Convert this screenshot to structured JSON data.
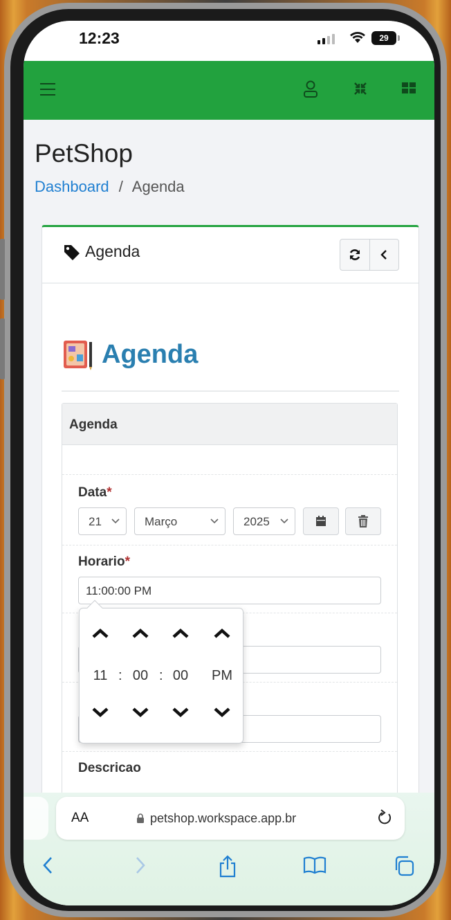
{
  "status": {
    "time": "12:23",
    "battery": "29"
  },
  "app": {
    "title": "PetShop",
    "breadcrumb": {
      "home": "Dashboard",
      "separator": "/",
      "current": "Agenda"
    }
  },
  "card": {
    "title": "Agenda",
    "heading": "Agenda",
    "panel_title": "Agenda"
  },
  "form": {
    "data_label": "Data",
    "day": "21",
    "month": "Março",
    "year": "2025",
    "horario_label": "Horario",
    "horario_value": "11:00:00 PM",
    "descricao_label": "Descricao",
    "required_mark": "*"
  },
  "time_picker": {
    "hour": "11",
    "minute": "00",
    "second": "00",
    "period": "PM",
    "separator": ":"
  },
  "browser": {
    "text_size_label": "AA",
    "url": "petshop.workspace.app.br"
  },
  "colors": {
    "brand_green": "#22a23e",
    "link_blue": "#1f7fd1",
    "heading_blue": "#2a7fb0",
    "required_red": "#b03030"
  },
  "icons": [
    "menu-icon",
    "user-icon",
    "compress-icon",
    "grid-icon",
    "tag-icon",
    "refresh-icon",
    "chevron-left-icon",
    "calendar-icon",
    "trash-icon",
    "chevron-up-icon",
    "chevron-down-icon",
    "lock-icon",
    "reload-icon",
    "back-icon",
    "forward-icon",
    "share-icon",
    "bookmarks-icon",
    "tabs-icon"
  ]
}
